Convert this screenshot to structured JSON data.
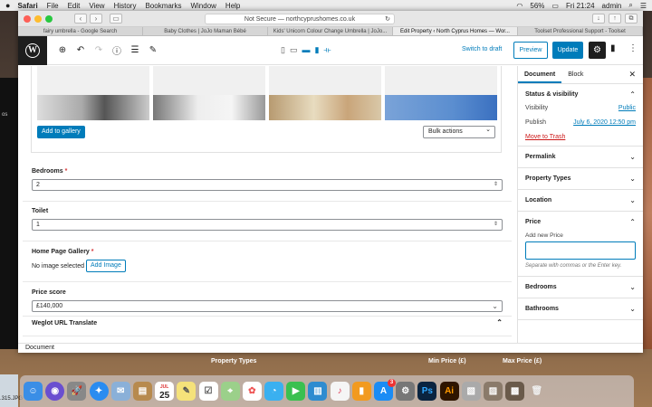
{
  "menubar": {
    "apple": "",
    "app": "Safari",
    "items": [
      "File",
      "Edit",
      "View",
      "History",
      "Bookmarks",
      "Window",
      "Help"
    ],
    "battery": "56%",
    "clock": "Fri 21:24",
    "user": "admin"
  },
  "browser": {
    "url": "Not Secure — northcyprushomes.co.uk",
    "tabs": [
      "fairy umbrella - Google Search",
      "Baby Clothes | JoJo Maman Bébé",
      "Kids' Unicorn Colour Change Umbrella | JoJo...",
      "Edit Property ‹ North Cyprus Homes — Wor...",
      "Toolset Professional Support - Toolset"
    ]
  },
  "toolbar": {
    "switch_draft": "Switch to draft",
    "preview": "Preview",
    "update": "Update"
  },
  "gallery": {
    "add_button": "Add to gallery",
    "bulk_actions": "Bulk actions"
  },
  "fields": {
    "bedrooms": {
      "label": "Bedrooms",
      "required": "*",
      "value": "2"
    },
    "toilet": {
      "label": "Toilet",
      "value": "1"
    },
    "homepage_gallery": {
      "label": "Home Page Gallery",
      "required": "*",
      "no_image": "No image selected",
      "add_image": "Add Image"
    },
    "price_score": {
      "label": "Price score",
      "value": "£140,000"
    },
    "weglot": {
      "label": "Weglot URL Translate"
    }
  },
  "footer": {
    "breadcrumb": "Document"
  },
  "sidebar": {
    "tabs": [
      "Document",
      "Block"
    ],
    "status": {
      "title": "Status & visibility",
      "visibility_label": "Visibility",
      "visibility_value": "Public",
      "publish_label": "Publish",
      "publish_value": "July 6, 2020 12:50 pm",
      "trash": "Move to Trash"
    },
    "panels": [
      "Permalink",
      "Property Types",
      "Location"
    ],
    "price": {
      "title": "Price",
      "add_new": "Add new Price",
      "hint": "Separate with commas or the Enter key."
    },
    "bottom_panels": [
      "Bedrooms",
      "Bathrooms"
    ]
  },
  "desktop": {
    "labels": [
      "Property Types",
      "Min Price (£)",
      "Max Price (£)"
    ],
    "file": ".315.JPG",
    "left_text": "os",
    "calendar_day": "25",
    "calendar_month": "JUL",
    "appstore_badge": "3"
  }
}
